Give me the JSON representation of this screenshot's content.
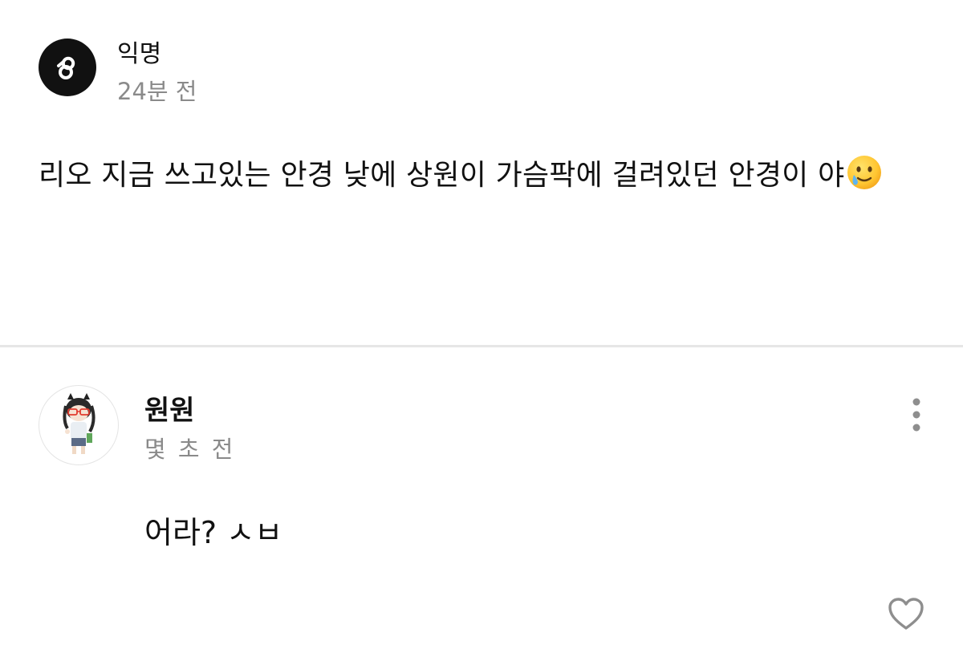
{
  "post": {
    "author": "익명",
    "time": "24분 전",
    "text": "리오 지금 쓰고있는 안경 낮에 상원이 가슴팍에 걸려있던 안경이 야",
    "emoji_icon": "smiling-face-with-tear-icon"
  },
  "comment": {
    "author": "원원",
    "time": "몇 초 전",
    "text": "어라? ㅅㅂ",
    "avatar_icon": "character-avatar-icon",
    "more_icon": "vertical-dots-icon",
    "like_icon": "heart-outline-icon"
  },
  "colors": {
    "text": "#111111",
    "secondary_text": "#8a8a8a",
    "divider": "#e6e6e6",
    "icon_gray": "#8e8e8e"
  }
}
